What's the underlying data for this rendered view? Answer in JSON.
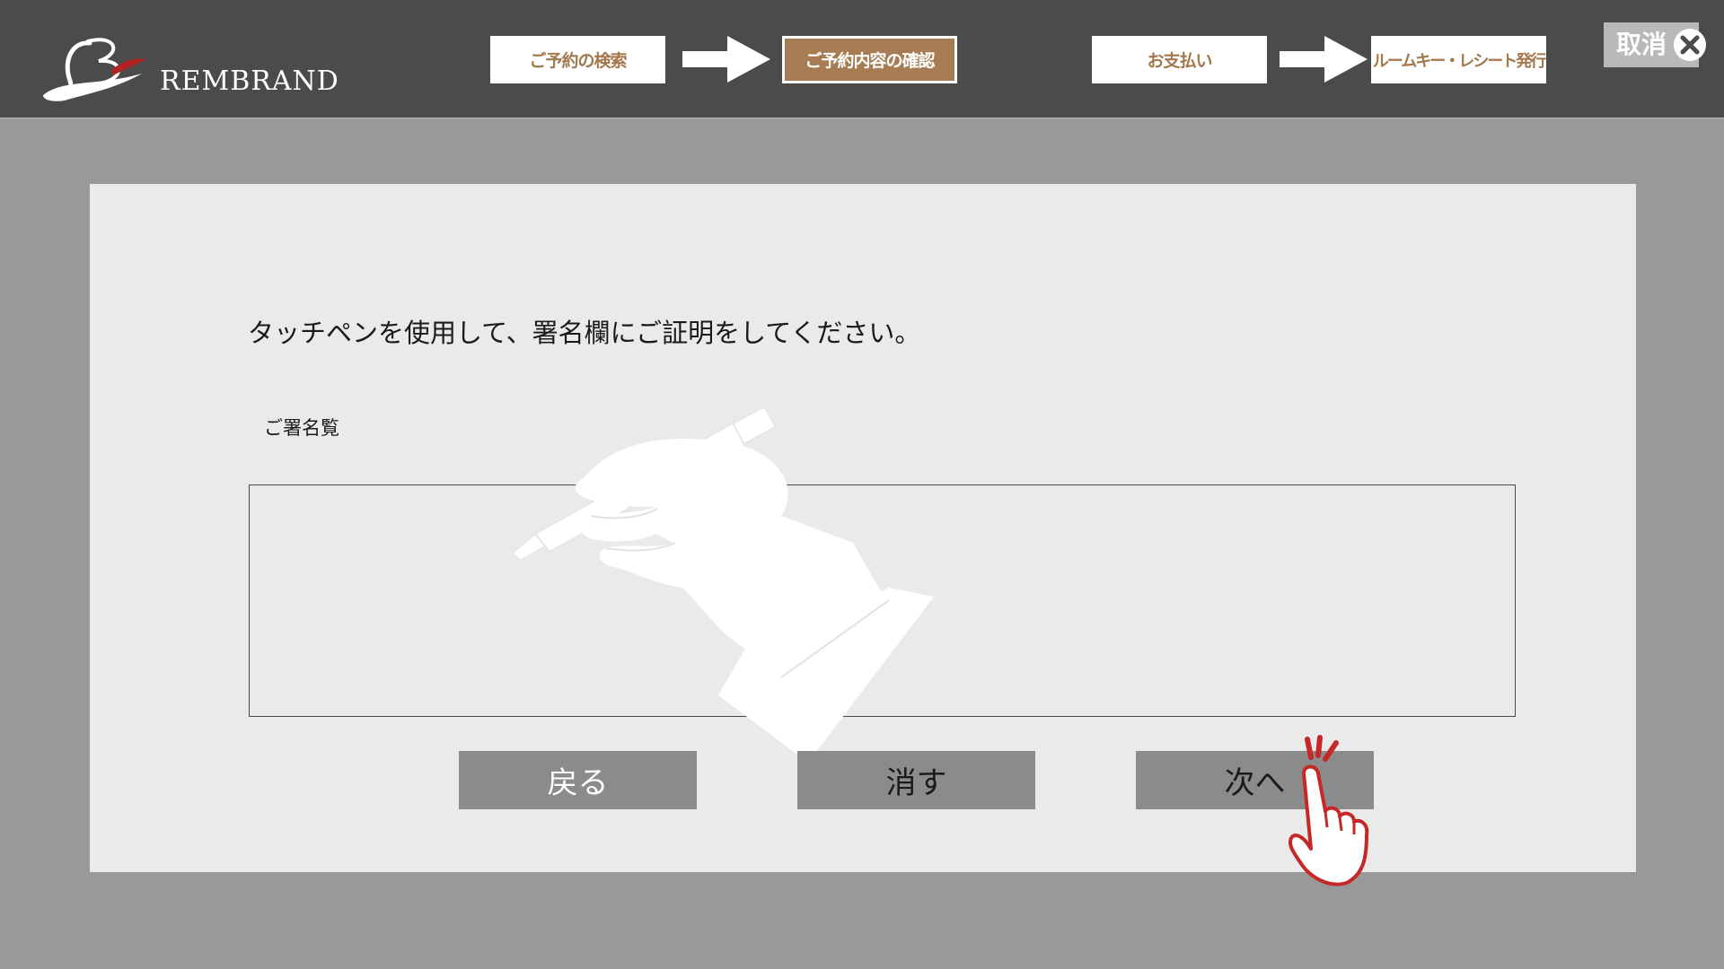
{
  "header": {
    "brand_name": "REMBRAND",
    "steps": [
      {
        "label": "ご予約の検索",
        "active": false
      },
      {
        "label": "ご予約内容の確認",
        "active": true
      },
      {
        "label": "お支払い",
        "active": false
      },
      {
        "label": "ルームキー・レシート発行",
        "active": false
      }
    ],
    "cancel_label": "取消"
  },
  "main": {
    "instruction": "タッチペンを使用して、署名欄にご証明をしてください。",
    "signature_label": "ご署名覧",
    "buttons": {
      "back": "戻る",
      "clear": "消す",
      "next": "次へ"
    }
  },
  "icons": {
    "logo": "rembrand-logo-icon",
    "step_arrow": "right-arrow-icon",
    "cancel": "close-icon",
    "illustration": "hand-holding-pen-icon",
    "pointer": "tap-hand-icon"
  },
  "colors": {
    "header_bg": "#4b4b4b",
    "page_bg": "#999999",
    "panel_bg": "#eaeaea",
    "accent_brown": "#a87c52",
    "button_gray": "#8b8b8b",
    "pointer_red": "#c62828"
  }
}
